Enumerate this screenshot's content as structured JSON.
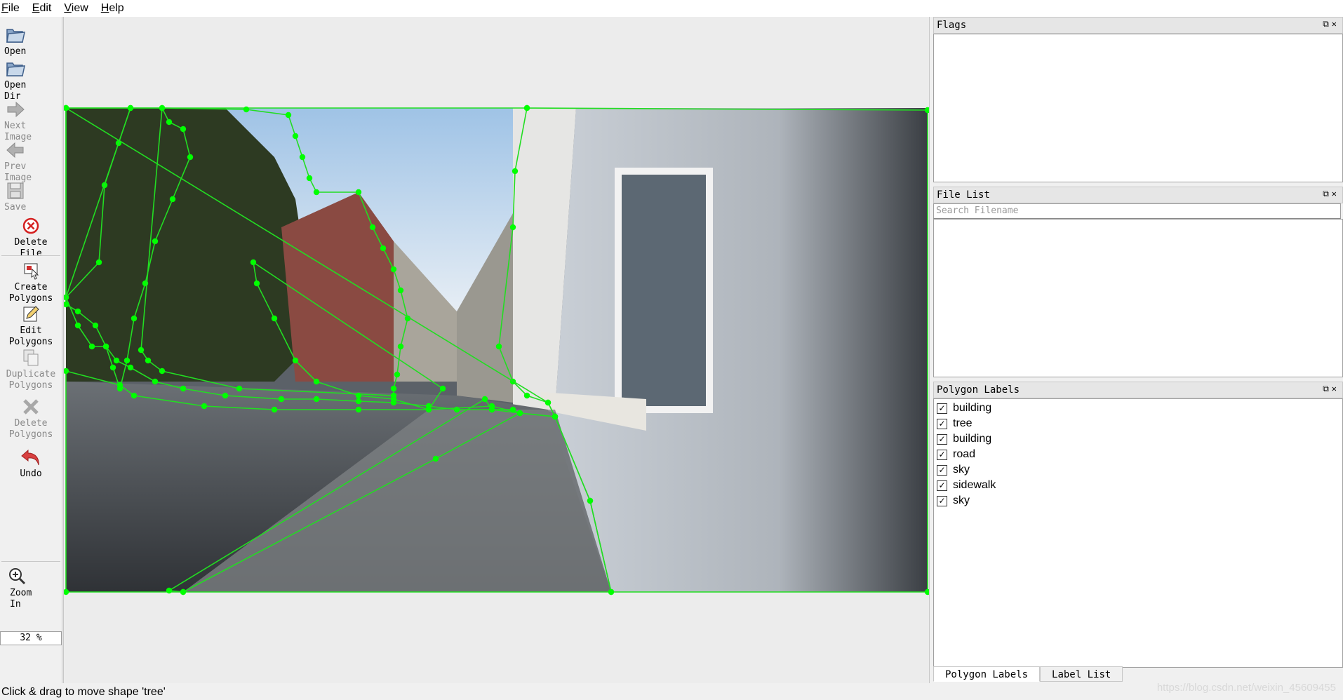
{
  "menu": [
    "File",
    "Edit",
    "View",
    "Help"
  ],
  "toolbar": {
    "open": "Open",
    "open_dir": "Open\nDir",
    "next_image": "Next\nImage",
    "prev_image": "Prev\nImage",
    "save": "Save",
    "delete_file": "Delete\nFile",
    "create_polygons": "Create\nPolygons",
    "edit_polygons": "Edit\nPolygons",
    "duplicate_polygons": "Duplicate\nPolygons",
    "delete_polygons": "Delete\nPolygons",
    "undo": "Undo",
    "zoom_in": "Zoom\nIn",
    "zoom_value": "32 %"
  },
  "docks": {
    "flags": {
      "title": "Flags"
    },
    "file_list": {
      "title": "File List",
      "search_placeholder": "Search Filename"
    },
    "polygon_labels": {
      "title": "Polygon Labels",
      "items": [
        "building",
        "tree",
        "building",
        "road",
        "sky",
        "sidewalk",
        "sky"
      ]
    }
  },
  "tabs": [
    "Polygon Labels",
    "Label List"
  ],
  "status": "Click & drag to move shape 'tree'",
  "watermark": "https://blog.csdn.net/weixin_45609455",
  "colors": {
    "polygon": "#22dd22",
    "vertex": "#00ff00"
  }
}
